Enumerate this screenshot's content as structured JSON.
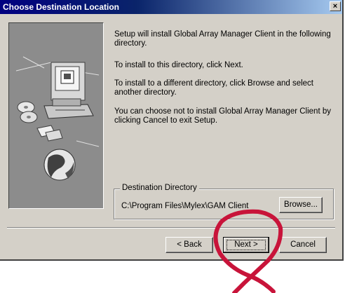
{
  "window": {
    "title": "Choose Destination Location",
    "close_glyph": "×"
  },
  "content": {
    "para1": "Setup will install Global Array Manager Client in the following directory.",
    "para2": "To install to this directory, click Next.",
    "para3": "To install to a different directory, click Browse and select another directory.",
    "para4": "You can choose not to install Global Array Manager Client by clicking Cancel to exit Setup."
  },
  "destination": {
    "group_label": "Destination Directory",
    "path": "C:\\Program Files\\Mylex\\GAM Client",
    "browse_label": "Browse..."
  },
  "buttons": {
    "back_label": "< Back",
    "next_label": "Next >",
    "cancel_label": "Cancel"
  },
  "colors": {
    "annotation": "#c8143a",
    "titlebar": "#000080",
    "face": "#d4d0c8"
  },
  "icons": [
    "computer-icon",
    "cd-icon",
    "disk-icon",
    "globe-icon"
  ]
}
